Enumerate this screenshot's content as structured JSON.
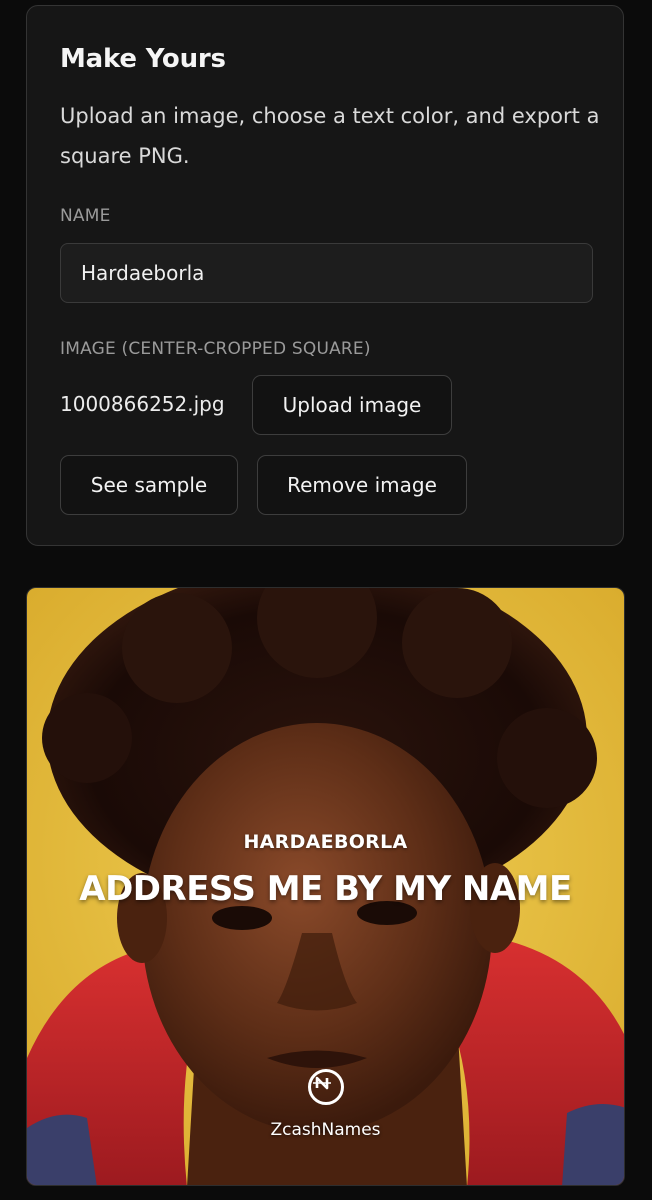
{
  "panel": {
    "title": "Make Yours",
    "description": "Upload an image, choose a text color, and export a square PNG.",
    "name_label": "NAME",
    "name_value": "Hardaeborla",
    "image_label": "IMAGE (CENTER-CROPPED SQUARE)",
    "file_name": "1000866252.jpg",
    "upload_button": "Upload image",
    "sample_button": "See sample",
    "remove_button": "Remove image"
  },
  "preview": {
    "name_text": "HARDAEBORLA",
    "headline": "ADDRESS ME BY MY NAME",
    "brand": "ZcashNames",
    "logo_icon": "zcashnames-logo-icon",
    "background_color": "#e9c23f",
    "hoodie_color": "#c8262a"
  }
}
